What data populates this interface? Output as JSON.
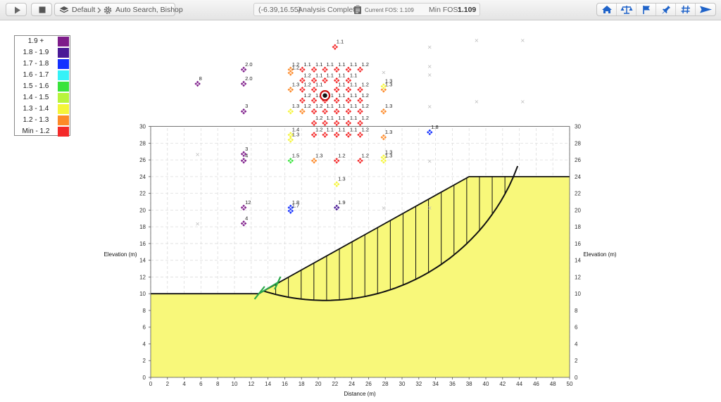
{
  "toolbar": {
    "scenario_group": "Default",
    "scenario_name": "Auto Search, Bishop"
  },
  "status": {
    "coordinates": "(-6.39,16.55)",
    "message": "Analysis Complete",
    "current_fos": "Current FOS: 1.109",
    "min_fos_label": "Min FOS:",
    "min_fos_value": "1.109"
  },
  "right_tools": [
    {
      "icon": "home-icon"
    },
    {
      "icon": "balance-scale-icon"
    },
    {
      "icon": "flag-icon"
    },
    {
      "icon": "pin-icon"
    },
    {
      "icon": "grid-icon"
    },
    {
      "icon": "send-icon"
    }
  ],
  "legend": [
    {
      "label": "1.9 +",
      "color": "#7e1c8a"
    },
    {
      "label": "1.8 - 1.9",
      "color": "#4a1a96"
    },
    {
      "label": "1.7 - 1.8",
      "color": "#1330ff"
    },
    {
      "label": "1.6 - 1.7",
      "color": "#35f2f7"
    },
    {
      "label": "1.5 - 1.6",
      "color": "#38e33b"
    },
    {
      "label": "1.4 - 1.5",
      "color": "#b8f43c"
    },
    {
      "label": "1.3 - 1.4",
      "color": "#f5f53a"
    },
    {
      "label": "1.2 - 1.3",
      "color": "#fd8a29"
    },
    {
      "label": "Min - 1.2",
      "color": "#f42a2a"
    }
  ],
  "axes": {
    "x_label": "Distance (m)",
    "y_label_left": "Elevation (m)",
    "y_label_right": "Elevation (m)",
    "x_ticks": [
      0,
      2,
      4,
      6,
      8,
      10,
      12,
      14,
      16,
      18,
      20,
      22,
      24,
      26,
      28,
      30,
      32,
      34,
      36,
      38,
      40,
      42,
      44,
      46,
      48,
      50
    ],
    "y_ticks": [
      0,
      2,
      4,
      6,
      8,
      10,
      12,
      14,
      16,
      18,
      20,
      22,
      24,
      26,
      28,
      30
    ]
  },
  "slope": {
    "surface": [
      [
        0,
        10
      ],
      [
        12.9,
        10
      ],
      [
        38,
        24
      ],
      [
        50,
        24
      ]
    ],
    "fill_color": "#f8f87a"
  },
  "slip_surface": {
    "center": [
      20.8,
      33.7
    ],
    "radius": 24.5,
    "entry_x": 13.4,
    "exit_x": 43.8,
    "slices": 20
  },
  "critical_center": [
    20.8,
    33.7
  ],
  "grid_points": [
    {
      "x": 22.0,
      "y": 39.5,
      "c": "#f42a2a",
      "t": "1.1"
    },
    {
      "x": 11.1,
      "y": 36.8,
      "c": "#7e1c8a",
      "t": "2.0"
    },
    {
      "x": 16.7,
      "y": 36.8,
      "c": "#fd8a29",
      "t": "1.2"
    },
    {
      "x": 16.7,
      "y": 36.4,
      "c": "#fd8a29",
      "t": "1.2"
    },
    {
      "x": 18.1,
      "y": 36.8,
      "c": "#f42a2a",
      "t": "1.1"
    },
    {
      "x": 19.5,
      "y": 36.8,
      "c": "#f42a2a",
      "t": "1.1"
    },
    {
      "x": 20.8,
      "y": 36.8,
      "c": "#f42a2a",
      "t": "1.1"
    },
    {
      "x": 22.2,
      "y": 36.8,
      "c": "#f42a2a",
      "t": "1.1"
    },
    {
      "x": 23.6,
      "y": 36.8,
      "c": "#f42a2a",
      "t": "1.1"
    },
    {
      "x": 25.0,
      "y": 36.8,
      "c": "#f42a2a",
      "t": "1.2"
    },
    {
      "x": 18.1,
      "y": 35.5,
      "c": "#f42a2a",
      "t": "1.2"
    },
    {
      "x": 19.5,
      "y": 35.5,
      "c": "#f42a2a",
      "t": "1.1"
    },
    {
      "x": 20.8,
      "y": 35.5,
      "c": "#f42a2a",
      "t": "1.1"
    },
    {
      "x": 22.2,
      "y": 35.5,
      "c": "#f42a2a",
      "t": "1.1"
    },
    {
      "x": 23.6,
      "y": 35.5,
      "c": "#f42a2a",
      "t": "1.1"
    },
    {
      "x": 5.6,
      "y": 35.1,
      "c": "#7e1c8a",
      "t": "8"
    },
    {
      "x": 11.1,
      "y": 35.1,
      "c": "#7e1c8a",
      "t": "2.0"
    },
    {
      "x": 16.7,
      "y": 34.4,
      "c": "#fd8a29",
      "t": "1.3"
    },
    {
      "x": 18.1,
      "y": 34.4,
      "c": "#f42a2a",
      "t": "1.2"
    },
    {
      "x": 19.5,
      "y": 34.4,
      "c": "#f42a2a",
      "t": "1.1"
    },
    {
      "x": 22.2,
      "y": 34.4,
      "c": "#f42a2a",
      "t": "1.1"
    },
    {
      "x": 23.6,
      "y": 34.4,
      "c": "#f42a2a",
      "t": "1.1"
    },
    {
      "x": 25.0,
      "y": 34.4,
      "c": "#f42a2a",
      "t": "1.2"
    },
    {
      "x": 27.8,
      "y": 34.4,
      "c": "#fd8a29",
      "t": "1.3"
    },
    {
      "x": 27.8,
      "y": 34.8,
      "c": "#f5f53a",
      "t": "1.3"
    },
    {
      "x": 18.1,
      "y": 33.1,
      "c": "#f42a2a",
      "t": "1.2"
    },
    {
      "x": 19.5,
      "y": 33.1,
      "c": "#f42a2a",
      "t": "1.1"
    },
    {
      "x": 20.8,
      "y": 33.1,
      "c": "#f42a2a",
      "t": "1.1"
    },
    {
      "x": 22.2,
      "y": 33.1,
      "c": "#f42a2a",
      "t": "1.1"
    },
    {
      "x": 23.6,
      "y": 33.1,
      "c": "#f42a2a",
      "t": "1.1"
    },
    {
      "x": 25.0,
      "y": 33.1,
      "c": "#f42a2a",
      "t": "1.2"
    },
    {
      "x": 11.1,
      "y": 31.8,
      "c": "#7e1c8a",
      "t": "3"
    },
    {
      "x": 16.7,
      "y": 31.8,
      "c": "#f5f53a",
      "t": "1.3"
    },
    {
      "x": 18.1,
      "y": 31.8,
      "c": "#fd8a29",
      "t": "1.2"
    },
    {
      "x": 19.5,
      "y": 31.8,
      "c": "#f42a2a",
      "t": "1.2"
    },
    {
      "x": 20.8,
      "y": 31.8,
      "c": "#f42a2a",
      "t": "1.1"
    },
    {
      "x": 22.2,
      "y": 31.8,
      "c": "#f42a2a",
      "t": "1.1"
    },
    {
      "x": 23.6,
      "y": 31.8,
      "c": "#f42a2a",
      "t": "1.1"
    },
    {
      "x": 25.0,
      "y": 31.8,
      "c": "#f42a2a",
      "t": "1.2"
    },
    {
      "x": 27.8,
      "y": 31.8,
      "c": "#fd8a29",
      "t": "1.3"
    },
    {
      "x": 19.5,
      "y": 30.4,
      "c": "#f42a2a",
      "t": "1.2"
    },
    {
      "x": 20.8,
      "y": 30.4,
      "c": "#f42a2a",
      "t": "1.1"
    },
    {
      "x": 22.2,
      "y": 30.4,
      "c": "#f42a2a",
      "t": "1.1"
    },
    {
      "x": 23.6,
      "y": 30.4,
      "c": "#f42a2a",
      "t": "1.1"
    },
    {
      "x": 25.0,
      "y": 30.4,
      "c": "#f42a2a",
      "t": "1.2"
    },
    {
      "x": 33.3,
      "y": 29.3,
      "c": "#1330ff",
      "t": "1.8"
    },
    {
      "x": 16.7,
      "y": 29.0,
      "c": "#f5f53a",
      "t": "1.4"
    },
    {
      "x": 16.7,
      "y": 28.4,
      "c": "#f5f53a",
      "t": "1.3"
    },
    {
      "x": 19.5,
      "y": 29.0,
      "c": "#f42a2a",
      "t": "1.2"
    },
    {
      "x": 20.8,
      "y": 29.0,
      "c": "#f42a2a",
      "t": "1.1"
    },
    {
      "x": 22.2,
      "y": 29.0,
      "c": "#f42a2a",
      "t": "1.1"
    },
    {
      "x": 23.6,
      "y": 29.0,
      "c": "#f42a2a",
      "t": "1.1"
    },
    {
      "x": 25.0,
      "y": 29.0,
      "c": "#f42a2a",
      "t": "1.2"
    },
    {
      "x": 27.8,
      "y": 28.7,
      "c": "#fd8a29",
      "t": "1.3"
    },
    {
      "x": 11.1,
      "y": 26.7,
      "c": "#7e1c8a",
      "t": "3"
    },
    {
      "x": 11.1,
      "y": 25.9,
      "c": "#7e1c8a",
      "t": "4"
    },
    {
      "x": 16.7,
      "y": 25.9,
      "c": "#38e33b",
      "t": "1.5"
    },
    {
      "x": 19.5,
      "y": 25.9,
      "c": "#fd8a29",
      "t": "1.3"
    },
    {
      "x": 22.2,
      "y": 25.9,
      "c": "#f42a2a",
      "t": "1.2"
    },
    {
      "x": 25.0,
      "y": 25.9,
      "c": "#f42a2a",
      "t": "1.2"
    },
    {
      "x": 27.8,
      "y": 26.3,
      "c": "#f5f53a",
      "t": "1.3"
    },
    {
      "x": 27.8,
      "y": 25.9,
      "c": "#f5f53a",
      "t": "1.3"
    },
    {
      "x": 22.2,
      "y": 23.1,
      "c": "#f5f53a",
      "t": "1.3"
    },
    {
      "x": 11.1,
      "y": 20.3,
      "c": "#7e1c8a",
      "t": "12"
    },
    {
      "x": 16.7,
      "y": 20.3,
      "c": "#1330ff",
      "t": "1.8"
    },
    {
      "x": 16.7,
      "y": 19.9,
      "c": "#1330ff",
      "t": "1.7"
    },
    {
      "x": 22.2,
      "y": 20.3,
      "c": "#4a1a96",
      "t": "1.9"
    },
    {
      "x": 11.1,
      "y": 18.4,
      "c": "#7e1c8a",
      "t": "4"
    }
  ],
  "grey_points": [
    [
      38.9,
      40.3
    ],
    [
      44.4,
      40.3
    ],
    [
      33.3,
      39.5
    ],
    [
      27.8,
      36.5
    ],
    [
      33.3,
      37.2
    ],
    [
      33.3,
      36.2
    ],
    [
      33.3,
      32.4
    ],
    [
      38.9,
      33.0
    ],
    [
      44.4,
      33.0
    ],
    [
      5.6,
      26.7
    ],
    [
      33.3,
      25.9
    ],
    [
      5.6,
      18.4
    ],
    [
      27.8,
      20.3
    ],
    [
      33.3,
      20.3
    ]
  ]
}
